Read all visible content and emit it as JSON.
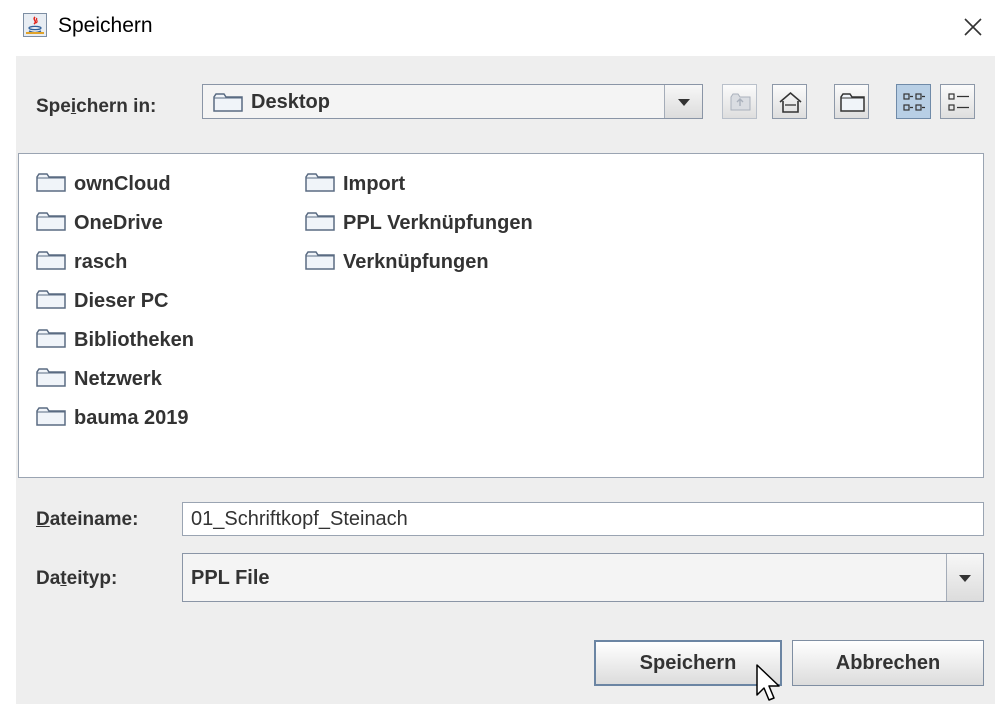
{
  "window": {
    "title": "Speichern",
    "icon": "java-app-icon",
    "close_icon": "close-icon"
  },
  "lookin": {
    "label_before": "Spe",
    "label_mnemonic": "i",
    "label_after": "chern in:",
    "value": "Desktop",
    "value_icon": "folder-icon"
  },
  "toolbar": {
    "buttons": [
      {
        "icon": "up-folder-icon",
        "enabled": false
      },
      {
        "icon": "home-icon",
        "enabled": true
      },
      {
        "icon": "new-folder-icon",
        "enabled": true
      },
      {
        "icon": "list-view-icon",
        "enabled": true,
        "selected": true
      },
      {
        "icon": "details-view-icon",
        "enabled": true
      }
    ]
  },
  "files": {
    "col1": [
      "ownCloud",
      "OneDrive",
      "rasch",
      "Dieser PC",
      "Bibliotheken",
      "Netzwerk",
      "bauma 2019"
    ],
    "col2": [
      "Import",
      "PPL Verknüpfungen",
      "Verknüpfungen"
    ]
  },
  "filename": {
    "label_mnemonic": "D",
    "label_after": "ateiname:",
    "value": "01_Schriftkopf_Steinach"
  },
  "filetype": {
    "label_before": "Da",
    "label_mnemonic": "t",
    "label_after": "eityp:",
    "value": "PPL File"
  },
  "buttons": {
    "save": "Speichern",
    "cancel": "Abbrechen"
  },
  "colors": {
    "background": "#eeeeee",
    "folder_outline": "#5a6b82",
    "selected_toggle": "#b8cfe5"
  }
}
